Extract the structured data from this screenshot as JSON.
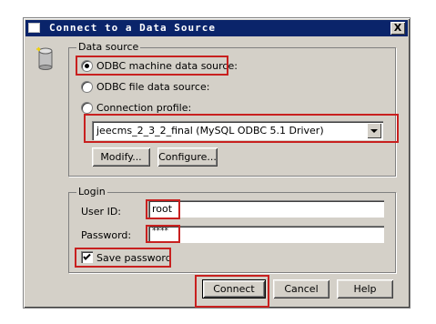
{
  "window": {
    "title": "Connect to a Data Source",
    "close_glyph": "X"
  },
  "data_source": {
    "group_label": "Data source",
    "options": [
      {
        "label": "ODBC machine data source:",
        "selected": true
      },
      {
        "label": "ODBC file data source:",
        "selected": false
      },
      {
        "label": "Connection profile:",
        "selected": false
      }
    ],
    "profile_select_value": "jeecms_2_3_2_final (MySQL ODBC 5.1 Driver)",
    "modify_label": "Modify...",
    "configure_label": "Configure..."
  },
  "login": {
    "group_label": "Login",
    "user_id_label": "User ID:",
    "user_id_value": "root",
    "password_label": "Password:",
    "password_value": "****",
    "save_password_label": "Save password",
    "save_password_checked": true
  },
  "buttons": {
    "connect": "Connect",
    "cancel": "Cancel",
    "help": "Help"
  },
  "colors": {
    "titlebar": "#0a246a",
    "highlight": "#c8201f",
    "dialog_bg": "#d4d0c8"
  },
  "icons": [
    "database-icon",
    "window-icon",
    "close-icon",
    "dropdown-arrow-icon",
    "checkmark-icon"
  ]
}
